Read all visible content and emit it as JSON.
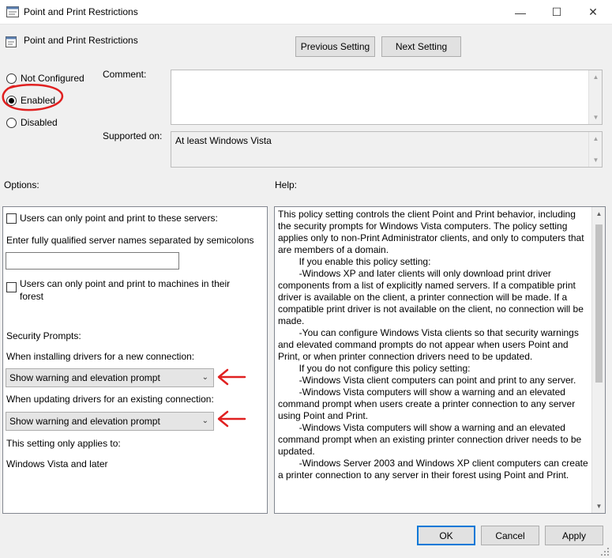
{
  "window": {
    "title": "Point and Print Restrictions",
    "controls": {
      "minimize": "—",
      "maximize": "☐",
      "close": "✕"
    }
  },
  "header": {
    "title": "Point and Print Restrictions",
    "prev_button": "Previous Setting",
    "next_button": "Next Setting"
  },
  "state": {
    "options": [
      "Not Configured",
      "Enabled",
      "Disabled"
    ],
    "selected": "Enabled"
  },
  "comment": {
    "label": "Comment:",
    "value": ""
  },
  "supported": {
    "label": "Supported on:",
    "value": "At least Windows Vista"
  },
  "section_labels": {
    "options": "Options:",
    "help": "Help:"
  },
  "options_panel": {
    "checkbox1_label": "Users can only point and print to these servers:",
    "server_field_label": "Enter fully qualified server names separated by semicolons",
    "server_field_value": "",
    "checkbox2_label": "Users can only point and print to machines in their forest",
    "security_prompts_label": "Security Prompts:",
    "installing_label": "When installing drivers for a new connection:",
    "installing_value": "Show warning and elevation prompt",
    "updating_label": "When updating drivers for an existing connection:",
    "updating_value": "Show warning and elevation prompt",
    "applies_label": "This setting only applies to:",
    "applies_value": "Windows Vista and later"
  },
  "help_text": [
    "This policy setting controls the client Point and Print behavior, including the security prompts for Windows Vista computers. The policy setting applies only to non-Print Administrator clients, and only to computers that are members of a domain.",
    "",
    "        If you enable this policy setting:",
    "        -Windows XP and later clients will only download print driver components from a list of explicitly named servers. If a compatible print driver is available on the client, a printer connection will be made. If a compatible print driver is not available on the client, no connection will be made.",
    "        -You can configure Windows Vista clients so that security warnings and elevated command prompts do not appear when users Point and Print, or when printer connection drivers need to be updated.",
    "",
    "        If you do not configure this policy setting:",
    "        -Windows Vista client computers can point and print to any server.",
    "        -Windows Vista computers will show a warning and an elevated command prompt when users create a printer connection to any server using Point and Print.",
    "        -Windows Vista computers will show a warning and an elevated command prompt when an existing printer connection driver needs to be updated.",
    "        -Windows Server 2003 and Windows XP client computers can create a printer connection to any server in their forest using Point and Print."
  ],
  "footer": {
    "ok": "OK",
    "cancel": "Cancel",
    "apply": "Apply"
  },
  "annotation_color": "#e02020",
  "accent_color": "#0078d7"
}
